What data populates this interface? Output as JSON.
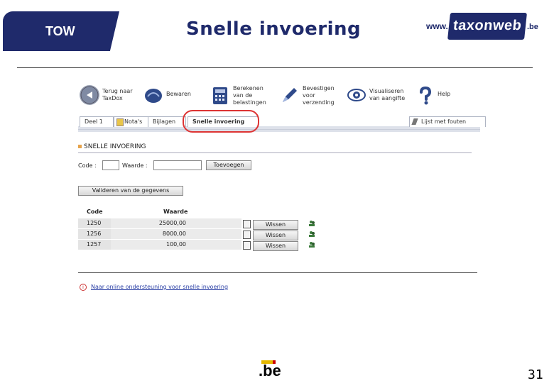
{
  "slide": {
    "tow_label": "TOW",
    "title": "Snelle invoering",
    "brand_www": "www.",
    "brand_name": "taxonweb",
    "brand_tld": ".be",
    "logo_text": ".be",
    "page_number": "31"
  },
  "toolbar": {
    "items": [
      {
        "label": "Terug naar\nTaxDox",
        "icon": "back-arrow-icon"
      },
      {
        "label": "Bewaren",
        "icon": "save-hand-icon"
      },
      {
        "label": "Berekenen\nvan de\nbelastingen",
        "icon": "calculator-icon"
      },
      {
        "label": "Bevestigen\nvoor\nverzending",
        "icon": "pen-sign-icon"
      },
      {
        "label": "Visualiseren\nvan aangifte",
        "icon": "eye-icon"
      },
      {
        "label": "Help",
        "icon": "question-mark-icon"
      }
    ]
  },
  "tabs": {
    "items": [
      "Deel 1",
      "Nota's",
      "Bijlagen",
      "Snelle invoering"
    ],
    "error_list": "Lijst met fouten"
  },
  "section_title": "SNELLE INVOERING",
  "form": {
    "code_label": "Code :",
    "waarde_label": "Waarde :",
    "add_button": "Toevoegen",
    "validate_button": "Valideren van de gegevens"
  },
  "table": {
    "headers": [
      "Code",
      "Waarde"
    ],
    "rows": [
      {
        "code": "1250",
        "value": "25000,00",
        "action": "Wissen"
      },
      {
        "code": "1256",
        "value": "8000,00",
        "action": "Wissen"
      },
      {
        "code": "1257",
        "value": "100,00",
        "action": "Wissen"
      }
    ]
  },
  "help_link": "Naar online ondersteuning voor snelle invoering",
  "colors": {
    "brand_navy": "#1f2a6b",
    "highlight_red": "#dd3333",
    "link_blue": "#2a3fa5"
  }
}
